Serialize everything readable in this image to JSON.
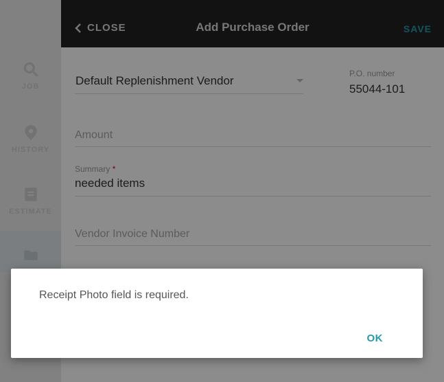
{
  "sidebar": {
    "items": [
      {
        "label": "JOB",
        "icon": "search-icon"
      },
      {
        "label": "HISTORY",
        "icon": "location-pin-icon"
      },
      {
        "label": "ESTIMATE",
        "icon": "document-icon"
      },
      {
        "label": "",
        "icon": "folder-icon"
      }
    ]
  },
  "header": {
    "close_label": "CLOSE",
    "title": "Add Purchase Order",
    "save_label": "SAVE"
  },
  "form": {
    "vendor": "Default Replenishment Vendor",
    "po_number_label": "P.O. number",
    "po_number": "55044-101",
    "amount_placeholder": "Amount",
    "summary_label": "Summary",
    "summary_required_mark": "*",
    "summary_value": "needed items",
    "vendor_invoice_placeholder": "Vendor Invoice Number"
  },
  "dialog": {
    "message": "Receipt Photo field is required.",
    "ok_label": "OK"
  },
  "colors": {
    "accent": "#1e9bb0",
    "header_bg": "#222222",
    "required": "#d0021b"
  }
}
